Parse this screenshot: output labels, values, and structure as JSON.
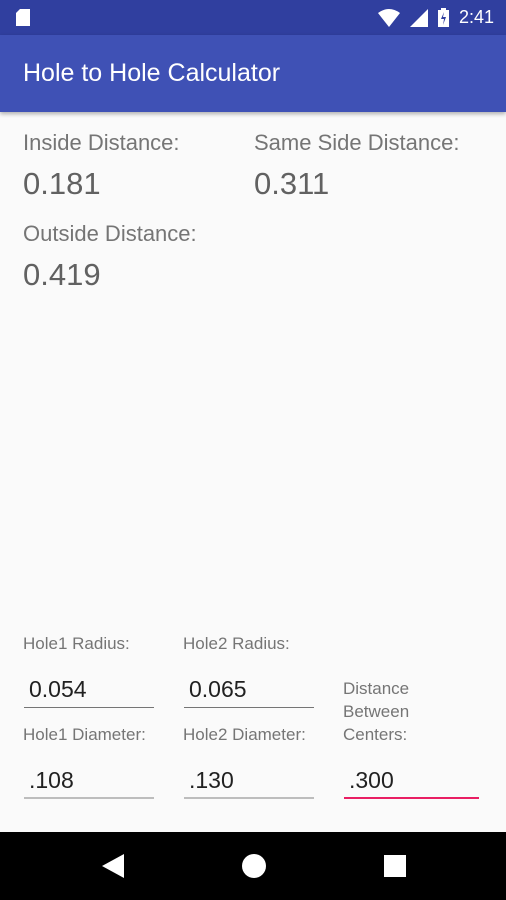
{
  "status_bar": {
    "time": "2:41",
    "icons": [
      "sd-card-icon",
      "wifi-icon",
      "signal-icon",
      "battery-charging-icon"
    ]
  },
  "app_bar": {
    "title": "Hole to Hole Calculator"
  },
  "results": {
    "inside_label": "Inside Distance:",
    "inside_value": "0.181",
    "same_side_label": "Same Side Distance:",
    "same_side_value": "0.311",
    "outside_label": "Outside Distance:",
    "outside_value": "0.419"
  },
  "inputs": {
    "hole1_radius_label": "Hole1 Radius:",
    "hole1_radius_value": "0.054",
    "hole2_radius_label": "Hole2 Radius:",
    "hole2_radius_value": "0.065",
    "hole1_diameter_label": "Hole1 Diameter:",
    "hole1_diameter_value": ".108",
    "hole2_diameter_label": "Hole2 Diameter:",
    "hole2_diameter_value": ".130",
    "distance_label_lines": [
      "Distance",
      "Between",
      "Centers:"
    ],
    "distance_value": ".300"
  },
  "nav_bar": {
    "icons": [
      "back-icon",
      "home-icon",
      "recents-icon"
    ]
  },
  "colors": {
    "primary": "#3f51b5",
    "primary_dark": "#303f9f",
    "accent": "#e91e63"
  }
}
